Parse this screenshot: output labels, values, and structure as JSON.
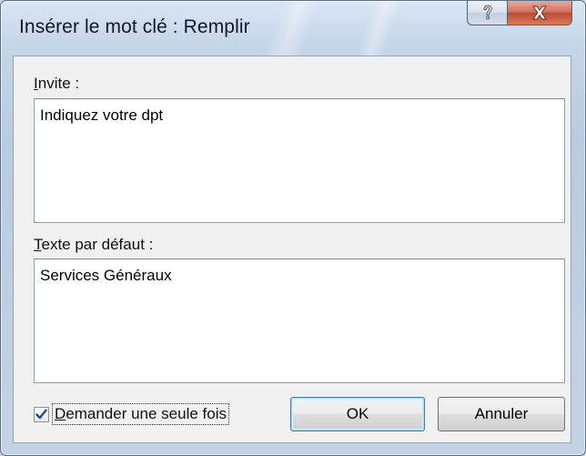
{
  "window": {
    "title": "Insérer le mot clé : Remplir"
  },
  "caption_buttons": {
    "help_icon": "help-question-icon",
    "close_icon": "close-x-icon"
  },
  "prompt_field": {
    "label_accesskey": "I",
    "label_rest": "nvite :",
    "value": "Indiquez votre dpt"
  },
  "default_text_field": {
    "label_accesskey": "T",
    "label_rest": "exte par défaut :",
    "value": "Services Généraux"
  },
  "ask_once": {
    "checked": true,
    "label_accesskey": "D",
    "label_rest": "emander une seule fois"
  },
  "buttons": {
    "ok_label": "OK",
    "cancel_label": "Annuler"
  },
  "colors": {
    "default_button_border": "#3c7fb1",
    "close_button": "#c04b31"
  }
}
